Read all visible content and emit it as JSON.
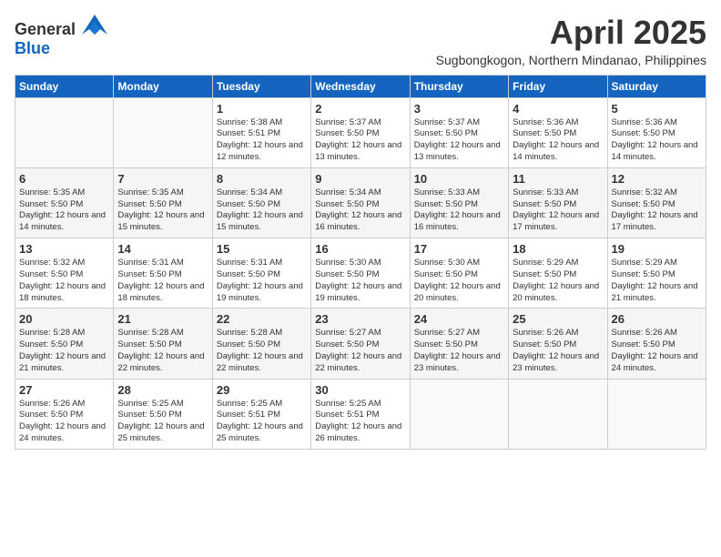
{
  "logo": {
    "general": "General",
    "blue": "Blue"
  },
  "title": "April 2025",
  "subtitle": "Sugbongkogon, Northern Mindanao, Philippines",
  "weekdays": [
    "Sunday",
    "Monday",
    "Tuesday",
    "Wednesday",
    "Thursday",
    "Friday",
    "Saturday"
  ],
  "weeks": [
    [
      {
        "day": "",
        "sunrise": "",
        "sunset": "",
        "daylight": ""
      },
      {
        "day": "",
        "sunrise": "",
        "sunset": "",
        "daylight": ""
      },
      {
        "day": "1",
        "sunrise": "Sunrise: 5:38 AM",
        "sunset": "Sunset: 5:51 PM",
        "daylight": "Daylight: 12 hours and 12 minutes."
      },
      {
        "day": "2",
        "sunrise": "Sunrise: 5:37 AM",
        "sunset": "Sunset: 5:50 PM",
        "daylight": "Daylight: 12 hours and 13 minutes."
      },
      {
        "day": "3",
        "sunrise": "Sunrise: 5:37 AM",
        "sunset": "Sunset: 5:50 PM",
        "daylight": "Daylight: 12 hours and 13 minutes."
      },
      {
        "day": "4",
        "sunrise": "Sunrise: 5:36 AM",
        "sunset": "Sunset: 5:50 PM",
        "daylight": "Daylight: 12 hours and 14 minutes."
      },
      {
        "day": "5",
        "sunrise": "Sunrise: 5:36 AM",
        "sunset": "Sunset: 5:50 PM",
        "daylight": "Daylight: 12 hours and 14 minutes."
      }
    ],
    [
      {
        "day": "6",
        "sunrise": "Sunrise: 5:35 AM",
        "sunset": "Sunset: 5:50 PM",
        "daylight": "Daylight: 12 hours and 14 minutes."
      },
      {
        "day": "7",
        "sunrise": "Sunrise: 5:35 AM",
        "sunset": "Sunset: 5:50 PM",
        "daylight": "Daylight: 12 hours and 15 minutes."
      },
      {
        "day": "8",
        "sunrise": "Sunrise: 5:34 AM",
        "sunset": "Sunset: 5:50 PM",
        "daylight": "Daylight: 12 hours and 15 minutes."
      },
      {
        "day": "9",
        "sunrise": "Sunrise: 5:34 AM",
        "sunset": "Sunset: 5:50 PM",
        "daylight": "Daylight: 12 hours and 16 minutes."
      },
      {
        "day": "10",
        "sunrise": "Sunrise: 5:33 AM",
        "sunset": "Sunset: 5:50 PM",
        "daylight": "Daylight: 12 hours and 16 minutes."
      },
      {
        "day": "11",
        "sunrise": "Sunrise: 5:33 AM",
        "sunset": "Sunset: 5:50 PM",
        "daylight": "Daylight: 12 hours and 17 minutes."
      },
      {
        "day": "12",
        "sunrise": "Sunrise: 5:32 AM",
        "sunset": "Sunset: 5:50 PM",
        "daylight": "Daylight: 12 hours and 17 minutes."
      }
    ],
    [
      {
        "day": "13",
        "sunrise": "Sunrise: 5:32 AM",
        "sunset": "Sunset: 5:50 PM",
        "daylight": "Daylight: 12 hours and 18 minutes."
      },
      {
        "day": "14",
        "sunrise": "Sunrise: 5:31 AM",
        "sunset": "Sunset: 5:50 PM",
        "daylight": "Daylight: 12 hours and 18 minutes."
      },
      {
        "day": "15",
        "sunrise": "Sunrise: 5:31 AM",
        "sunset": "Sunset: 5:50 PM",
        "daylight": "Daylight: 12 hours and 19 minutes."
      },
      {
        "day": "16",
        "sunrise": "Sunrise: 5:30 AM",
        "sunset": "Sunset: 5:50 PM",
        "daylight": "Daylight: 12 hours and 19 minutes."
      },
      {
        "day": "17",
        "sunrise": "Sunrise: 5:30 AM",
        "sunset": "Sunset: 5:50 PM",
        "daylight": "Daylight: 12 hours and 20 minutes."
      },
      {
        "day": "18",
        "sunrise": "Sunrise: 5:29 AM",
        "sunset": "Sunset: 5:50 PM",
        "daylight": "Daylight: 12 hours and 20 minutes."
      },
      {
        "day": "19",
        "sunrise": "Sunrise: 5:29 AM",
        "sunset": "Sunset: 5:50 PM",
        "daylight": "Daylight: 12 hours and 21 minutes."
      }
    ],
    [
      {
        "day": "20",
        "sunrise": "Sunrise: 5:28 AM",
        "sunset": "Sunset: 5:50 PM",
        "daylight": "Daylight: 12 hours and 21 minutes."
      },
      {
        "day": "21",
        "sunrise": "Sunrise: 5:28 AM",
        "sunset": "Sunset: 5:50 PM",
        "daylight": "Daylight: 12 hours and 22 minutes."
      },
      {
        "day": "22",
        "sunrise": "Sunrise: 5:28 AM",
        "sunset": "Sunset: 5:50 PM",
        "daylight": "Daylight: 12 hours and 22 minutes."
      },
      {
        "day": "23",
        "sunrise": "Sunrise: 5:27 AM",
        "sunset": "Sunset: 5:50 PM",
        "daylight": "Daylight: 12 hours and 22 minutes."
      },
      {
        "day": "24",
        "sunrise": "Sunrise: 5:27 AM",
        "sunset": "Sunset: 5:50 PM",
        "daylight": "Daylight: 12 hours and 23 minutes."
      },
      {
        "day": "25",
        "sunrise": "Sunrise: 5:26 AM",
        "sunset": "Sunset: 5:50 PM",
        "daylight": "Daylight: 12 hours and 23 minutes."
      },
      {
        "day": "26",
        "sunrise": "Sunrise: 5:26 AM",
        "sunset": "Sunset: 5:50 PM",
        "daylight": "Daylight: 12 hours and 24 minutes."
      }
    ],
    [
      {
        "day": "27",
        "sunrise": "Sunrise: 5:26 AM",
        "sunset": "Sunset: 5:50 PM",
        "daylight": "Daylight: 12 hours and 24 minutes."
      },
      {
        "day": "28",
        "sunrise": "Sunrise: 5:25 AM",
        "sunset": "Sunset: 5:50 PM",
        "daylight": "Daylight: 12 hours and 25 minutes."
      },
      {
        "day": "29",
        "sunrise": "Sunrise: 5:25 AM",
        "sunset": "Sunset: 5:51 PM",
        "daylight": "Daylight: 12 hours and 25 minutes."
      },
      {
        "day": "30",
        "sunrise": "Sunrise: 5:25 AM",
        "sunset": "Sunset: 5:51 PM",
        "daylight": "Daylight: 12 hours and 26 minutes."
      },
      {
        "day": "",
        "sunrise": "",
        "sunset": "",
        "daylight": ""
      },
      {
        "day": "",
        "sunrise": "",
        "sunset": "",
        "daylight": ""
      },
      {
        "day": "",
        "sunrise": "",
        "sunset": "",
        "daylight": ""
      }
    ]
  ]
}
